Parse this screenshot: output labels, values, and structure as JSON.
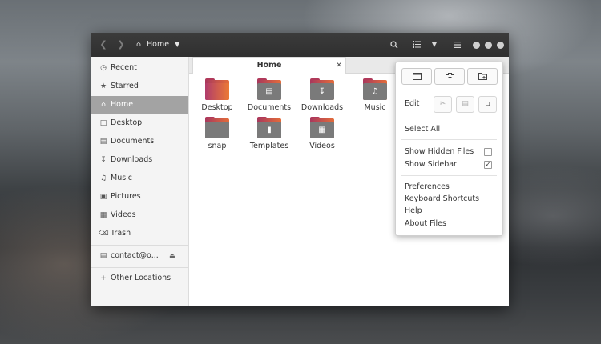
{
  "header": {
    "location": "Home"
  },
  "sidebar": {
    "items": [
      {
        "label": "Recent",
        "icon": "clock-icon"
      },
      {
        "label": "Starred",
        "icon": "star-icon"
      },
      {
        "label": "Home",
        "icon": "home-icon"
      },
      {
        "label": "Desktop",
        "icon": "desktop-icon"
      },
      {
        "label": "Documents",
        "icon": "document-icon"
      },
      {
        "label": "Downloads",
        "icon": "download-icon"
      },
      {
        "label": "Music",
        "icon": "music-icon"
      },
      {
        "label": "Pictures",
        "icon": "picture-icon"
      },
      {
        "label": "Videos",
        "icon": "video-icon"
      },
      {
        "label": "Trash",
        "icon": "trash-icon"
      }
    ],
    "account": "contact@o...",
    "other": "Other Locations"
  },
  "tab": {
    "title": "Home"
  },
  "files": [
    {
      "name": "Desktop",
      "icon": "folder-desktop-icon"
    },
    {
      "name": "Documents",
      "icon": "folder-documents-icon"
    },
    {
      "name": "Downloads",
      "icon": "folder-downloads-icon"
    },
    {
      "name": "Music",
      "icon": "folder-music-icon"
    },
    {
      "name": "snap",
      "icon": "folder-icon"
    },
    {
      "name": "Templates",
      "icon": "folder-templates-icon"
    },
    {
      "name": "Videos",
      "icon": "folder-videos-icon"
    }
  ],
  "menu": {
    "edit": "Edit",
    "select_all": "Select All",
    "show_hidden": "Show Hidden Files",
    "show_hidden_checked": false,
    "show_sidebar": "Show Sidebar",
    "show_sidebar_checked": true,
    "preferences": "Preferences",
    "shortcuts": "Keyboard Shortcuts",
    "help": "Help",
    "about": "About Files"
  },
  "colors": {
    "header_bg": "#2f2f2f",
    "sidebar_active": "#a3a3a3",
    "folder_accent": "#e46d3a"
  }
}
